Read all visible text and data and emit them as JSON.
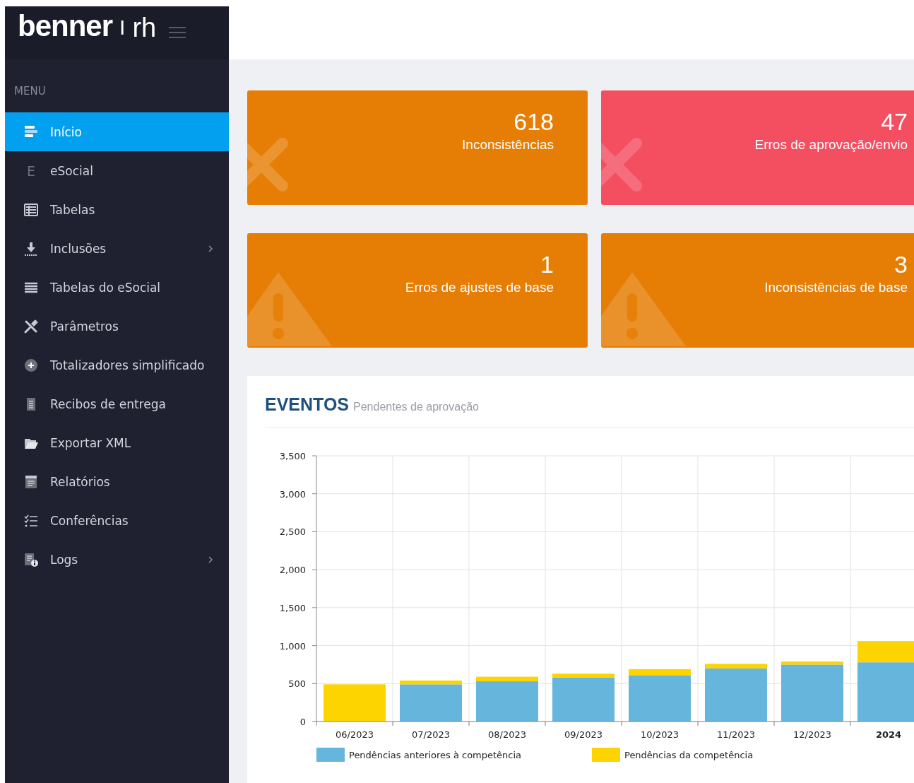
{
  "brand": {
    "logo": "benner",
    "separator": "I",
    "product": "rh"
  },
  "sidebar": {
    "heading": "MENU",
    "items": [
      {
        "label": "Início",
        "selected": true,
        "expandable": false
      },
      {
        "label": "eSocial",
        "selected": false,
        "expandable": false,
        "icon_text": "E"
      },
      {
        "label": "Tabelas",
        "selected": false,
        "expandable": false
      },
      {
        "label": "Inclusões",
        "selected": false,
        "expandable": true
      },
      {
        "label": "Tabelas do eSocial",
        "selected": false,
        "expandable": false
      },
      {
        "label": "Parâmetros",
        "selected": false,
        "expandable": false
      },
      {
        "label": "Totalizadores simplificado",
        "selected": false,
        "expandable": false
      },
      {
        "label": "Recibos de entrega",
        "selected": false,
        "expandable": false
      },
      {
        "label": "Exportar XML",
        "selected": false,
        "expandable": false
      },
      {
        "label": "Relatórios",
        "selected": false,
        "expandable": false
      },
      {
        "label": "Conferências",
        "selected": false,
        "expandable": false
      },
      {
        "label": "Logs",
        "selected": false,
        "expandable": true
      }
    ]
  },
  "cards": [
    {
      "kind": "error",
      "value": "618",
      "label": "Inconsistências",
      "color": "#e67e05"
    },
    {
      "kind": "error",
      "value": "47",
      "label": "Erros de aprovação/envio",
      "color": "#f44e61"
    },
    {
      "kind": "warning",
      "value": "1",
      "label": "Erros de ajustes de base",
      "color": "#e67e05"
    },
    {
      "kind": "warning",
      "value": "3",
      "label": "Inconsistências de base",
      "color": "#e67e05"
    }
  ],
  "events": {
    "title": "EVENTOS",
    "subtitle": "Pendentes de aprovação",
    "bold_last_category": true,
    "chart_data": {
      "type": "bar",
      "stacked": true,
      "categories": [
        "06/2023",
        "07/2023",
        "08/2023",
        "09/2023",
        "10/2023",
        "11/2023",
        "12/2023",
        "2024"
      ],
      "ylim": [
        0,
        3500
      ],
      "grid": true,
      "legend": true,
      "yticks": [
        {
          "value": 0,
          "label": "0"
        },
        {
          "value": 500,
          "label": "500"
        },
        {
          "value": 1000,
          "label": "1,000"
        },
        {
          "value": 1500,
          "label": "1,500"
        },
        {
          "value": 2000,
          "label": "2,000"
        },
        {
          "value": 2500,
          "label": "2,500"
        },
        {
          "value": 3000,
          "label": "3,000"
        },
        {
          "value": 3500,
          "label": "3,500"
        }
      ],
      "series": [
        {
          "name": "Pendências anteriores à competência",
          "color": "#66b5dc",
          "values": [
            0,
            490,
            530,
            580,
            610,
            700,
            750,
            780
          ]
        },
        {
          "name": "Pendências da competência",
          "color": "#fdd400",
          "values": [
            490,
            50,
            60,
            50,
            80,
            60,
            40,
            280
          ]
        }
      ]
    }
  }
}
